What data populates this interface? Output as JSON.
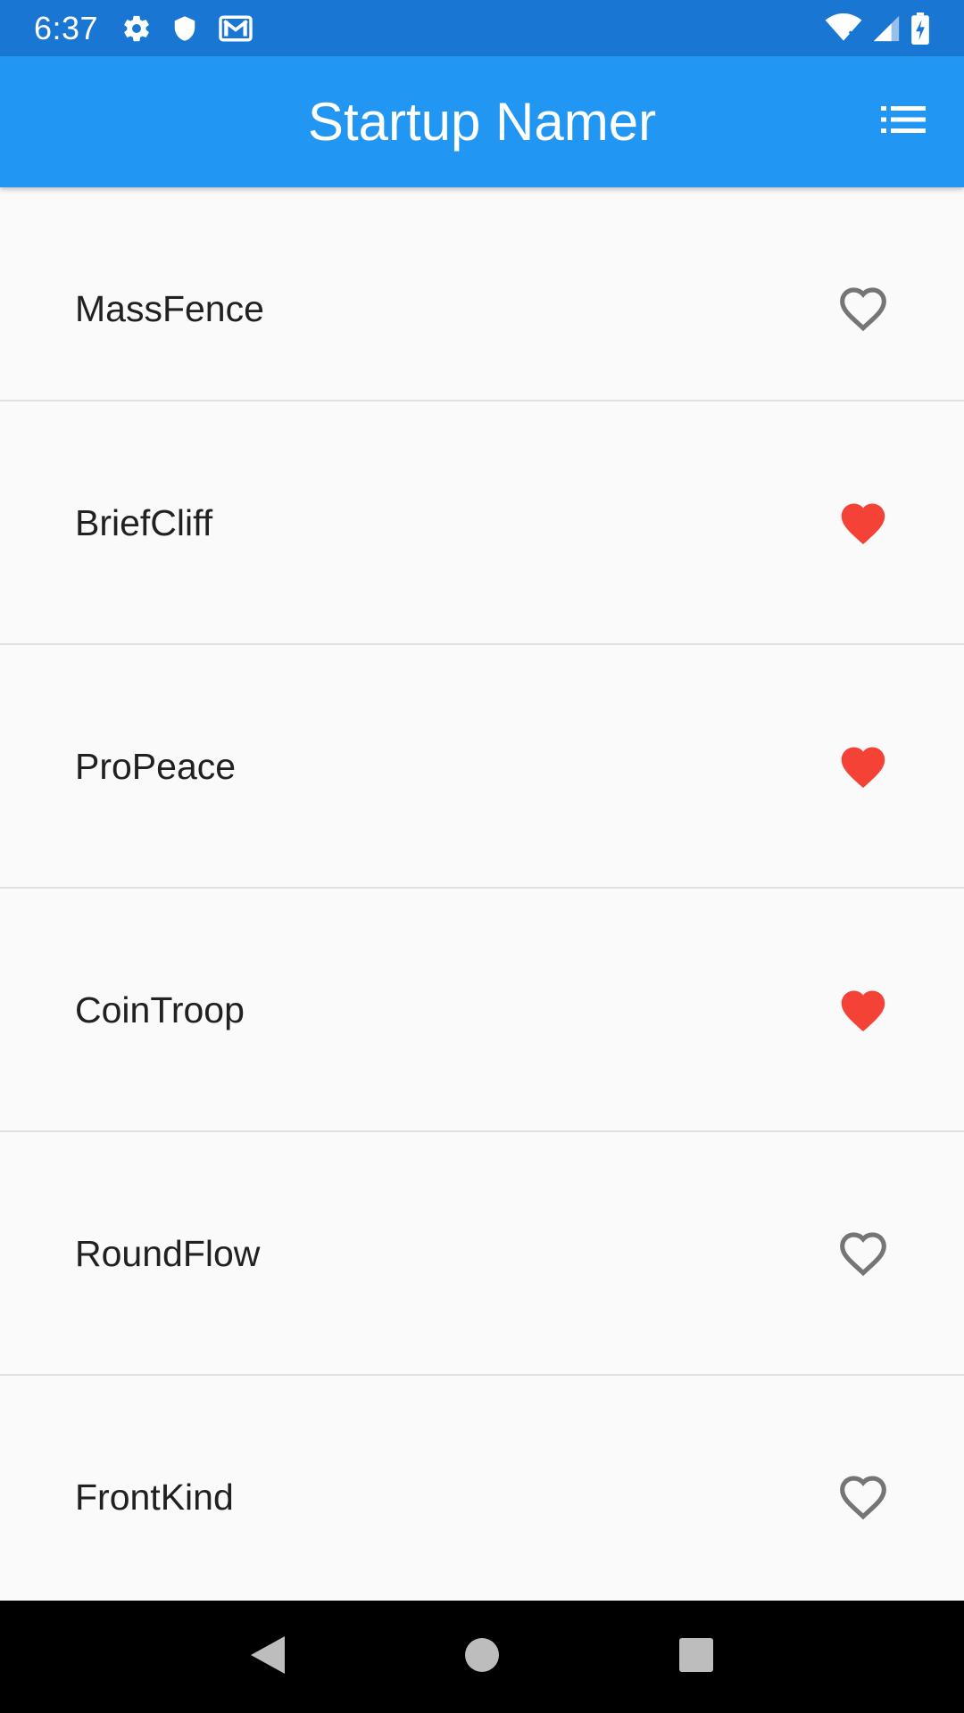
{
  "status_bar": {
    "time": "6:37",
    "left_icons": [
      "gear-icon",
      "shield-icon",
      "gmail-icon"
    ],
    "right_icons": [
      "wifi-icon",
      "signal-icon",
      "battery-charging-icon"
    ]
  },
  "app_bar": {
    "title": "Startup Namer",
    "action_icon": "list-icon"
  },
  "colors": {
    "status_bar": "#1976d2",
    "app_bar": "#2196f3",
    "favorite": "#f44336",
    "not_favorite": "#757575"
  },
  "items": [
    {
      "name": "MassFence",
      "favorited": false
    },
    {
      "name": "BriefCliff",
      "favorited": true
    },
    {
      "name": "ProPeace",
      "favorited": true
    },
    {
      "name": "CoinTroop",
      "favorited": true
    },
    {
      "name": "RoundFlow",
      "favorited": false
    },
    {
      "name": "FrontKind",
      "favorited": false
    }
  ],
  "nav_bar": {
    "buttons": [
      "back-icon",
      "home-icon",
      "recents-icon"
    ]
  }
}
